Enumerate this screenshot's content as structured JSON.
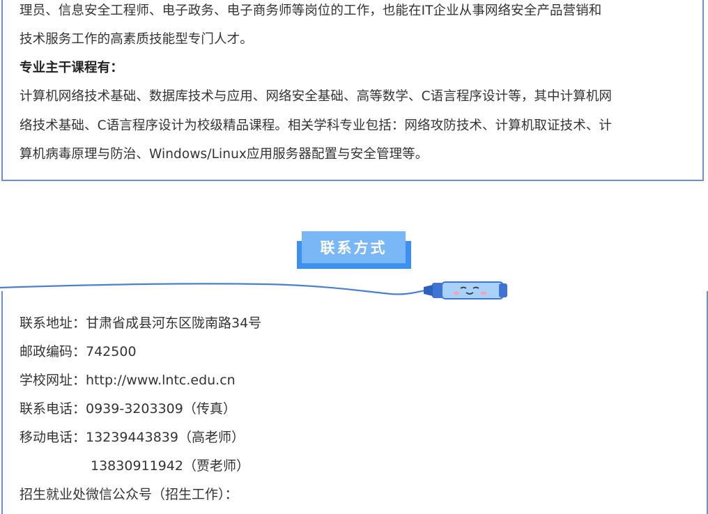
{
  "intro": {
    "line1": "理员、信息安全工程师、电子政务、电子商务师等岗位的工作，也能在IT企业从事网络安全产品营销和",
    "line2": "技术服务工作的高素质技能型专门人才。",
    "courses_heading": "专业主干课程有：",
    "courses_line1": "计算机网络技术基础、数据库技术与应用、网络安全基础、高等数学、C语言程序设计等，其中计算机网",
    "courses_line2": "络技术基础、C语言程序设计为校级精品课程。相关学科专业包括：网络攻防技术、计算机取证技术、计",
    "courses_line3": "算机病毒原理与防治、Windows/Linux应用服务器配置与安全管理等。"
  },
  "contact": {
    "title": "联系方式",
    "address": "联系地址：甘肃省成县河东区陇南路34号",
    "postcode": "邮政编码：742500",
    "website": "学校网址：http://www.lntc.edu.cn",
    "phone": "联系电话：0939-3203309（传真）",
    "mobile1": "移动电话：13239443839（高老师）",
    "mobile2": "13830911942（贾老师）",
    "wechat": "招生就业处微信公众号（招生工作）："
  },
  "colors": {
    "border": "#6f8fc4",
    "badge": "#7ab7f6",
    "badge_shadow": "#3d8ff0"
  }
}
